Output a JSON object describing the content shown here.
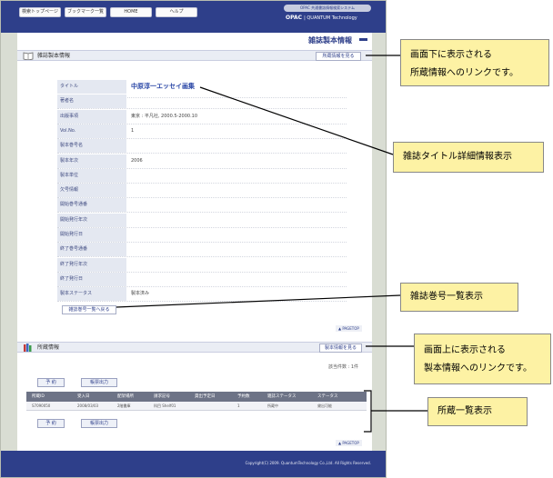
{
  "nav": {
    "items": [
      "検索トップページ",
      "ブックマーク一覧",
      "HOME",
      "ヘルプ"
    ],
    "brand_pill": "OPAC 共通書誌情報検索システム",
    "brand": "OPAC",
    "brand_sub": "| QUANTUM Technology"
  },
  "page": {
    "title": "雑誌製本情報"
  },
  "binding_section": {
    "title": "雑誌製本情報",
    "link": "所蔵情報を見る",
    "rows": [
      {
        "label": "タイトル",
        "value": "中原淳一エッセイ画集"
      },
      {
        "label": "著者名",
        "value": ""
      },
      {
        "label": "出版事項",
        "value": "東京 : 平凡社, 2000.5-2000.10"
      },
      {
        "label": "Vol.No.",
        "value": "1"
      },
      {
        "label": "製本巻号名",
        "value": ""
      },
      {
        "label": "製本年次",
        "value": "2006"
      },
      {
        "label": "製本単位",
        "value": ""
      },
      {
        "label": "欠号情報",
        "value": ""
      },
      {
        "label": "開始巻号通番",
        "value": ""
      },
      {
        "label": "開始発行年次",
        "value": ""
      },
      {
        "label": "開始発行日",
        "value": ""
      },
      {
        "label": "終了巻号通番",
        "value": ""
      },
      {
        "label": "終了発行年次",
        "value": ""
      },
      {
        "label": "終了発行日",
        "value": ""
      },
      {
        "label": "製本ステータス",
        "value": "製本済み"
      }
    ],
    "volume_list_link": "雑誌巻号一覧へ戻る",
    "pagetop": "PAGETOP"
  },
  "holdings_section": {
    "title": "所蔵情報",
    "link": "製本情報を見る",
    "count": "該当件数 : 1件",
    "buttons": [
      "予 約",
      "帳票出力"
    ],
    "columns": [
      "所蔵ID",
      "受入日",
      "配架場所",
      "請求記号",
      "貸出予定日",
      "予約数",
      "雑誌ステータス",
      "ステータス"
    ],
    "rows": [
      [
        "S7090050",
        "2008/03/03",
        "2階書庫",
        "科目 Shelf01",
        "",
        "1",
        "所蔵中",
        "貸出可能"
      ]
    ],
    "pagetop": "PAGETOP"
  },
  "footer": {
    "copyright": "Copyright(C) 2009. QuantumTechnology Co.,Ltd. All Rights Reserved."
  },
  "annotations": [
    {
      "lines": [
        "画面下に表示される",
        "所蔵情報へのリンクです。"
      ]
    },
    {
      "lines": [
        "雑誌タイトル詳細情報表示"
      ]
    },
    {
      "lines": [
        "雑誌巻号一覧表示"
      ]
    },
    {
      "lines": [
        "画面上に表示される",
        "製本情報へのリンクです。"
      ]
    },
    {
      "lines": [
        "所蔵一覧表示"
      ]
    }
  ],
  "colors": {
    "nav_blue": "#2e3f8a",
    "callout_yellow": "#fdf2a4",
    "label_bg": "#e4e8f1"
  }
}
